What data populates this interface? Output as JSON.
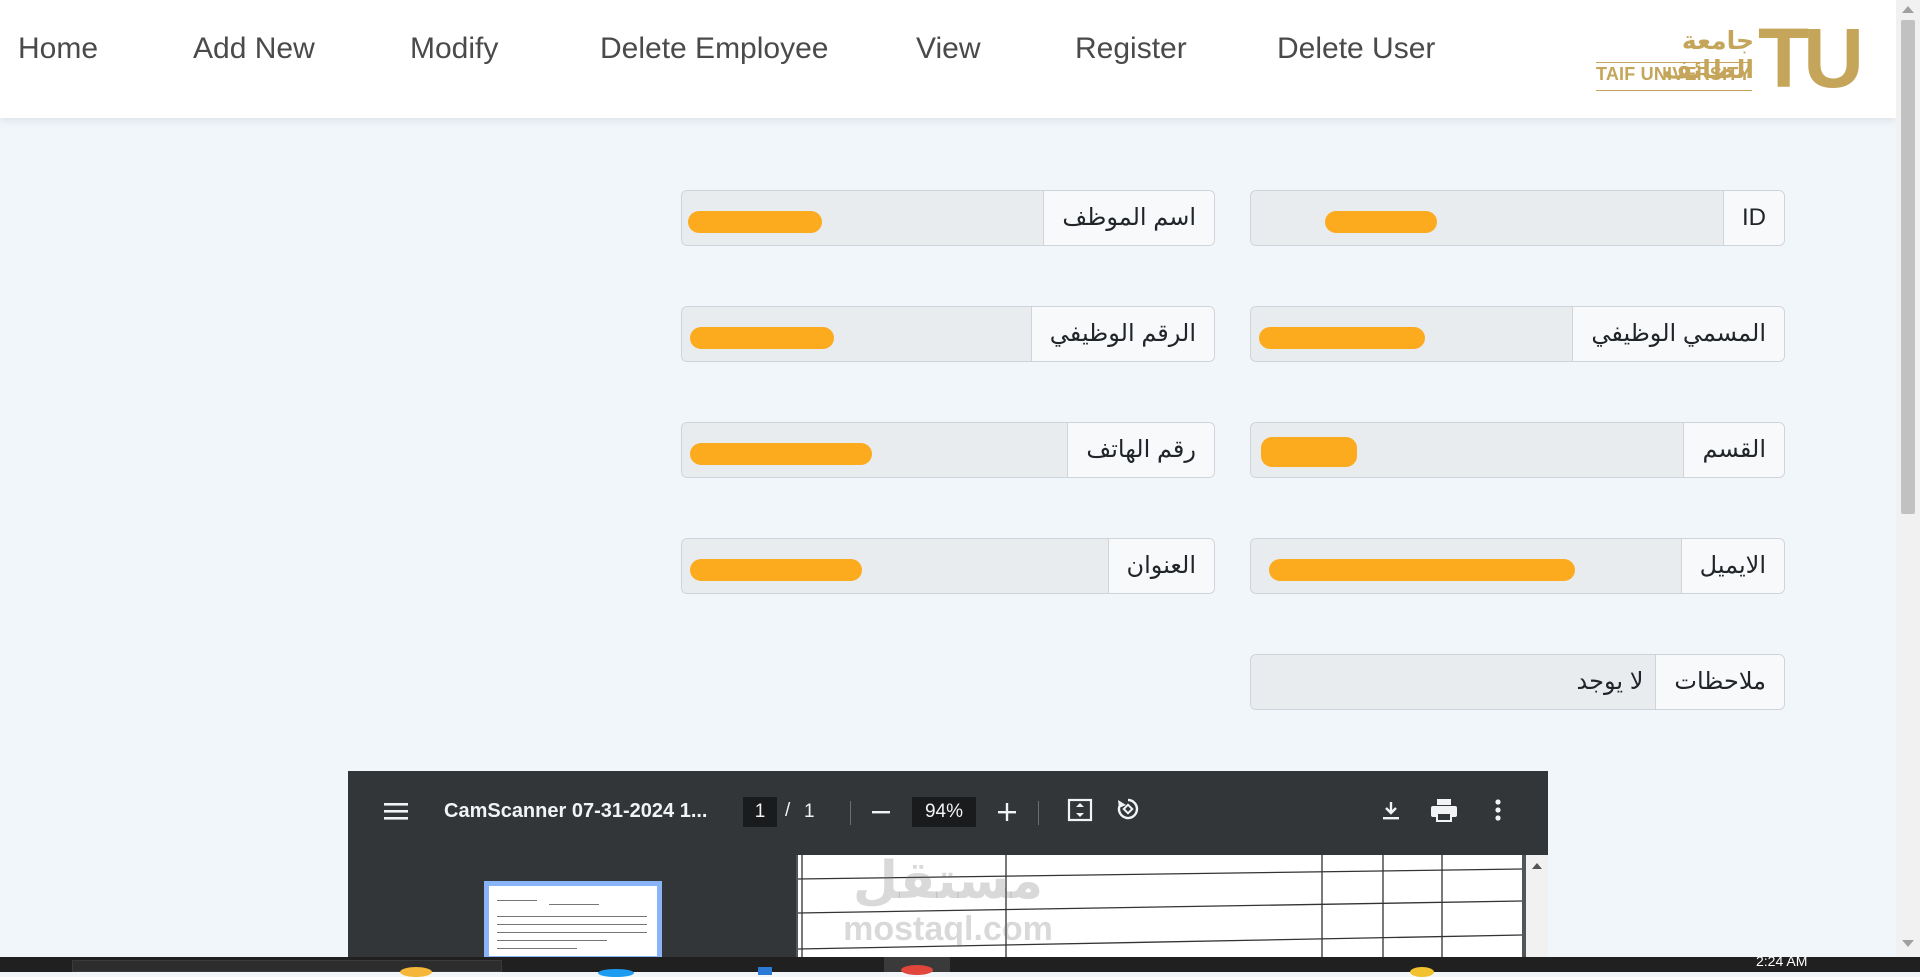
{
  "nav": {
    "items": [
      "Home",
      "Add New",
      "Modify",
      "Delete Employee",
      "View",
      "Register",
      "Delete User"
    ],
    "logo": {
      "arabic": "جامعة الطائف",
      "english": "TAIF UNIVERSITY",
      "mark": "TU"
    }
  },
  "form": {
    "fields": {
      "id": {
        "label": "ID",
        "value": ""
      },
      "employee_name": {
        "label": "اسم الموظف",
        "value": ""
      },
      "job_title": {
        "label": "المسمي الوظيفي",
        "value": ""
      },
      "employee_number": {
        "label": "الرقم الوظيفي",
        "value": ""
      },
      "department": {
        "label": "القسم",
        "value": ""
      },
      "phone": {
        "label": "رقم الهاتف",
        "value": ""
      },
      "email": {
        "label": "الايميل",
        "value": ""
      },
      "address": {
        "label": "العنوان",
        "value": ""
      },
      "notes": {
        "label": "ملاحظات",
        "value": "لا يوجد"
      }
    },
    "redaction_color": "#fcaa1e"
  },
  "pdf_viewer": {
    "title": "CamScanner 07-31-2024 1...",
    "page_current": "1",
    "page_separator": "/",
    "page_total": "1",
    "zoom": "94%",
    "icons": {
      "menu": "menu-icon",
      "zoom_out": "minus-icon",
      "zoom_in": "plus-icon",
      "fit": "fit-page-icon",
      "rotate": "rotate-icon",
      "download": "download-icon",
      "print": "print-icon",
      "more": "more-vertical-icon"
    },
    "watermark_text": "مستقل",
    "watermark_url": "mostaql.com"
  },
  "taskbar": {
    "time": "2:24 AM"
  },
  "colors": {
    "page_bg": "#f1f6fb",
    "logo_gold": "#c5a55a",
    "pdf_toolbar": "#323639"
  }
}
